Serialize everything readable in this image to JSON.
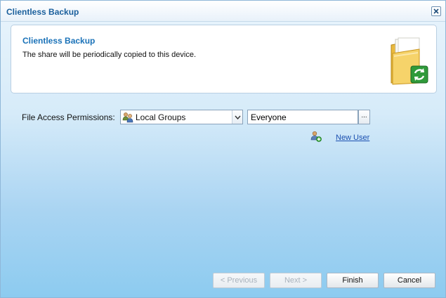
{
  "window": {
    "title": "Clientless Backup"
  },
  "header": {
    "title": "Clientless Backup",
    "description": "The share will be periodically copied to this device.",
    "icon": "folder-sync-icon"
  },
  "permissions": {
    "label": "File Access Permissions:",
    "group_select": {
      "value": "Local Groups",
      "icon": "group-icon"
    },
    "user_field": {
      "value": "Everyone"
    },
    "browse_label": "...",
    "new_user": {
      "label": "New User",
      "icon": "add-user-icon"
    }
  },
  "buttons": {
    "previous": "< Previous",
    "next": "Next >",
    "finish": "Finish",
    "cancel": "Cancel"
  },
  "colors": {
    "title": "#1a5f9c",
    "accent": "#1a72b8",
    "link": "#1a4fb0"
  }
}
